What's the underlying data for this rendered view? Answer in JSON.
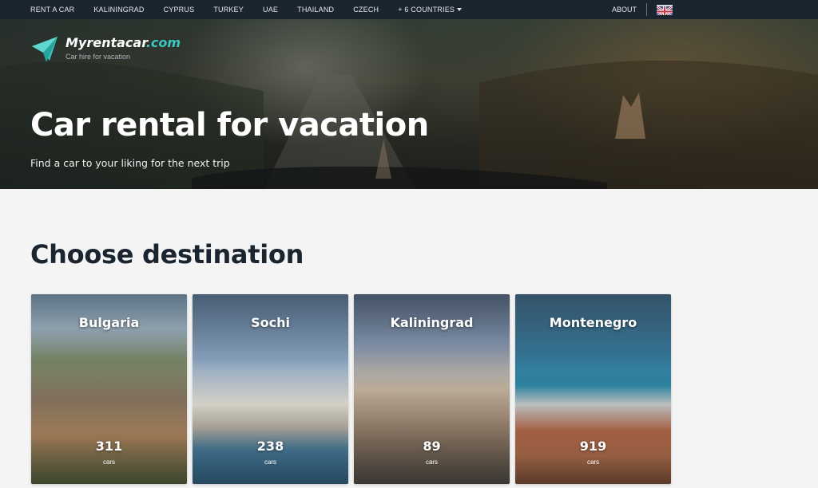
{
  "nav": {
    "links": [
      {
        "label": "RENT A CAR"
      },
      {
        "label": "KALININGRAD"
      },
      {
        "label": "CYPRUS"
      },
      {
        "label": "TURKEY"
      },
      {
        "label": "UAE"
      },
      {
        "label": "THAILAND"
      },
      {
        "label": "CZECH"
      },
      {
        "label": "+ 6 COUNTRIES"
      }
    ],
    "about": "ABOUT",
    "language_icon": "uk-flag-icon"
  },
  "brand": {
    "name_main": "Myrentacar",
    "name_suffix": ".com",
    "tagline": "Car hire for vacation",
    "accent_color": "#3cc6c0"
  },
  "hero": {
    "title": "Car rental for vacation",
    "subtitle": "Find a car to your liking for the next trip"
  },
  "destinations": {
    "title": "Choose destination",
    "items": [
      {
        "name": "Bulgaria",
        "count": "311",
        "unit": "cars"
      },
      {
        "name": "Sochi",
        "count": "238",
        "unit": "cars"
      },
      {
        "name": "Kaliningrad",
        "count": "89",
        "unit": "cars"
      },
      {
        "name": "Montenegro",
        "count": "919",
        "unit": "cars"
      }
    ]
  },
  "colors": {
    "nav_bg": "#1b2530",
    "heading": "#1b2530",
    "page_bg": "#f4f4f4"
  }
}
